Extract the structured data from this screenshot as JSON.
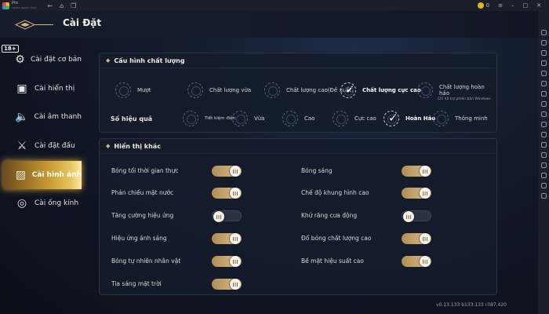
{
  "emulator": {
    "app_name": "Pro",
    "app_sub": "Lorem ipsum blue",
    "nav_back": "←",
    "nav_home": "⌂",
    "nav_tabs": "❐",
    "coin_count": "0",
    "menu_icon": "≡",
    "minimize": "–",
    "maximize": "□",
    "close": "✕"
  },
  "header": {
    "title": "Cài Đặt",
    "age_rating": "18+"
  },
  "menu": [
    {
      "label": "Cài đặt cơ bản",
      "icon": "gear-icon",
      "glyph": "⚙"
    },
    {
      "label": "Cài hiển thị",
      "icon": "monitor-icon",
      "glyph": "▣"
    },
    {
      "label": "Cài âm thanh",
      "icon": "speaker-icon",
      "glyph": "🔈"
    },
    {
      "label": "Cài đặt đấu",
      "icon": "swords-icon",
      "glyph": "⚔"
    },
    {
      "label": "Cài hình ảnh",
      "icon": "image-icon",
      "glyph": "▨"
    },
    {
      "label": "Cài ống kính",
      "icon": "lens-icon",
      "glyph": "◎"
    }
  ],
  "quality": {
    "heading": "Cấu hình chất lượng",
    "options": [
      "Mượt",
      "Chất lượng vừa",
      "Chất lượng cao(Đề xuất)",
      "Chất lượng cực cao",
      "Chất lượng hoàn hảo"
    ],
    "perfect_note": "Chỉ hỗ trợ phiên bản Windows",
    "effect_label": "Số hiệu quả",
    "effects": [
      "Tiết kiệm điện",
      "Vừa",
      "Cao",
      "Cực cao",
      "Hoàn Hảo",
      "Thông minh"
    ]
  },
  "other": {
    "heading": "Hiển thị khác",
    "left": [
      {
        "label": "Bóng tối thời gian thực",
        "on": true
      },
      {
        "label": "Phản chiếu mặt nước",
        "on": true
      },
      {
        "label": "Tăng cường hiệu ứng",
        "on": false
      },
      {
        "label": "Hiệu ứng ánh sáng",
        "on": true
      },
      {
        "label": "Bóng tự nhiên nhân vật",
        "on": true
      },
      {
        "label": "Tia sáng mặt trời",
        "on": true
      }
    ],
    "right": [
      {
        "label": "Bóng sáng",
        "on": true
      },
      {
        "label": "Chế độ khung hình cao",
        "on": true
      },
      {
        "label": "Khử răng cưa động",
        "on": false
      },
      {
        "label": "Đổ bóng chất lượng cao",
        "on": true
      },
      {
        "label": "Bề mặt hiệu suất cao",
        "on": true
      }
    ]
  },
  "version": "v0.13.133 b133.133 r387.420",
  "colors": {
    "accent_gold": "#d7b57a",
    "active_menu": "#c5962f"
  }
}
